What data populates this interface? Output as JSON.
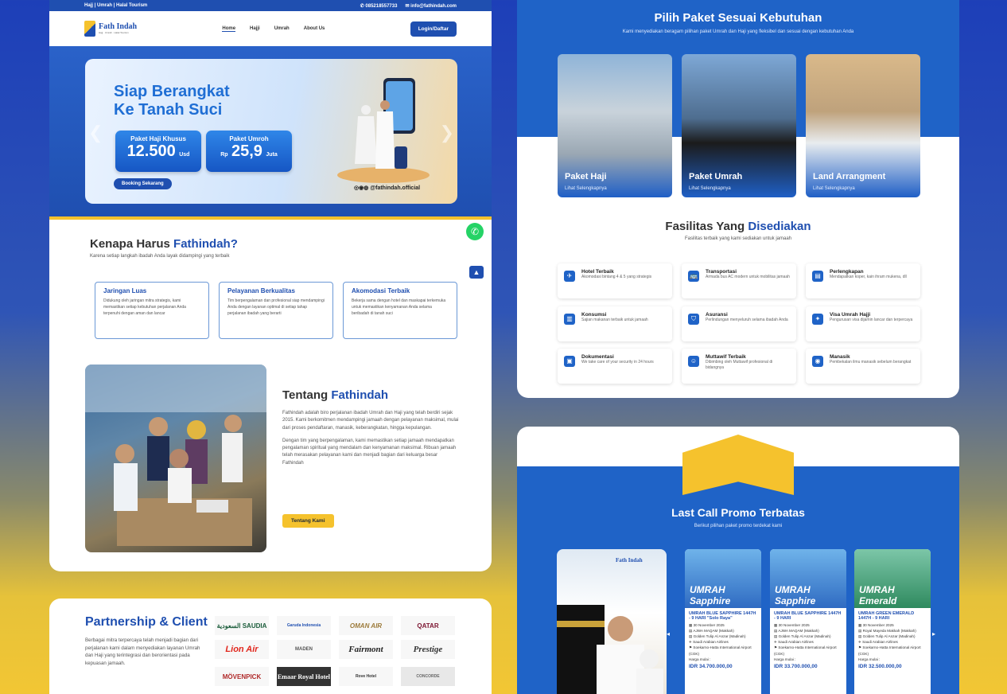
{
  "topbar": {
    "left": "Hajj | Umrah | Halal Tourism",
    "phone": "✆ 085218557733",
    "email": "✉ info@fathindah.com"
  },
  "brand": {
    "name": "Fath Indah",
    "tagline": "Hajj · Umrah · Halal Tourism"
  },
  "nav": {
    "items": [
      "Home",
      "Hajji",
      "Umrah",
      "About Us"
    ],
    "login": "Login/Daftar"
  },
  "hero": {
    "line1": "Siap Berangkat",
    "line2": "Ke Tanah Suci",
    "haji_title": "Paket Haji Khusus",
    "haji_value": "12.500",
    "haji_unit": "Usd",
    "umroh_title": "Paket Umroh",
    "umroh_prefix": "Rp",
    "umroh_value": "25,9",
    "umroh_unit": "Juta",
    "cta": "Booking Sekarang",
    "handle": "@fathindah.official"
  },
  "why": {
    "title_a": "Kenapa Harus",
    "title_b": "Fathindah?",
    "subtitle": "Karena setiap langkah ibadah Anda layak didampingi yang terbaik",
    "cards": [
      {
        "title": "Jaringan Luas",
        "desc": "Didukung oleh jaringan mitra strategis, kami memastikan setiap kebutuhan perjalanan Anda terpenuhi dengan aman dan lancar"
      },
      {
        "title": "Pelayanan Berkualitas",
        "desc": "Tim berpengalaman dan profesional siap mendampingi Anda dengan layanan optimal di setiap tahap perjalanan ibadah yang berarti"
      },
      {
        "title": "Akomodasi Terbaik",
        "desc": "Bekerja sama dengan hotel dan maskapai terkemuka untuk memastikan kenyamanan Anda selama beribadah di tanah suci"
      }
    ]
  },
  "about": {
    "title_a": "Tentang",
    "title_b": "Fathindah",
    "p1": "Fathindah adalah biro perjalanan ibadah Umrah dan Haji yang telah berdiri sejak 2015. Kami berkomitmen mendampingi jamaah dengan pelayanan maksimal, mulai dari proses pendaftaran, manasik, keberangkatan, hingga kepulangan.",
    "p2": "Dengan tim yang berpengalaman, kami memastikan setiap jamaah mendapatkan pengalaman spiritual yang mendalam dan kenyamanan maksimal. Ribuan jamaah telah merasakan pelayanan kami dan menjadi bagian dari keluarga besar Fathindah",
    "cta": "Tentang Kami"
  },
  "partner": {
    "title": "Partnership & Client",
    "desc": "Berbagai mitra terpercaya telah menjadi bagian dari perjalanan kami dalam menyediakan layanan Umrah dan Haji yang terintegrasi dan berorientasi pada kepuasan jamaah.",
    "logos": [
      "السعودية SAUDIA",
      "Garuda Indonesia",
      "OMAN AIR",
      "QATAR",
      "Lion Air",
      "MADEN",
      "Fairmont",
      "Prestige",
      "MÖVENPICK",
      "Emaar Royal Hotel",
      "Rove Hotel",
      "CONCORDE"
    ]
  },
  "packages": {
    "title": "Pilih Paket Sesuai Kebutuhan",
    "subtitle": "Kami menyediakan beragam pilihan paket Umrah dan Haji yang fleksibel dan sesuai dengan kebutuhan Anda",
    "items": [
      {
        "title": "Paket Haji",
        "link": "Lihat Selengkapnya"
      },
      {
        "title": "Paket Umrah",
        "link": "Lihat Selengkapnya"
      },
      {
        "title": "Land Arrangment",
        "link": "Lihat Selengkapnya"
      }
    ]
  },
  "facilities": {
    "title_a": "Fasilitas Yang",
    "title_b": "Disediakan",
    "subtitle": "Fasilitas terbaik yang kami sediakan untuk jamaah",
    "items": [
      {
        "title": "Hotel Terbaik",
        "desc": "Akomodasi bintang 4 & 5 yang strategis",
        "icon": "✈"
      },
      {
        "title": "Transportasi",
        "desc": "Armada bus AC modern untuk mobilitas jamaah",
        "icon": "🚌"
      },
      {
        "title": "Perlengkapan",
        "desc": "Mendapatkan koper, kain ihram mukena, dll",
        "icon": "▤"
      },
      {
        "title": "Konsumsi",
        "desc": "Sajian makanan terbaik untuk jamaah",
        "icon": "▥"
      },
      {
        "title": "Asuransi",
        "desc": "Perlindungan menyeluruh selama ibadah Anda",
        "icon": "⛉"
      },
      {
        "title": "Visa Umrah Hajji",
        "desc": "Pengurusan visa dijamin lancar dan terpercaya",
        "icon": "✦"
      },
      {
        "title": "Dokumentasi",
        "desc": "We take care of your security in 24 hours",
        "icon": "▣"
      },
      {
        "title": "Muttawif Terbaik",
        "desc": "Dibimbing oleh Muttawif profesional di bidangnya",
        "icon": "☺"
      },
      {
        "title": "Manasik",
        "desc": "Pembekalan ilmu manasik sebelum berangkat",
        "icon": "◉"
      }
    ]
  },
  "promo": {
    "title": "Last Call Promo Terbatas",
    "subtitle": "Berikut pilihan paket promo terdekat kami",
    "items": [
      {
        "badge": "UMRAH Sapphire",
        "title": "UMRAH BLUE SAPPHIRE 1447H - 9 HARI \"Solo Raya\"",
        "date": "30 November 2025",
        "l1": "AJWA MAQAM (Makkah)",
        "l2": "Golden Tulip Al Anzar (Madinah)",
        "l3": "Saudi Arabian Airlines",
        "l4": "Soekarno-Hatta International Airport (CGK)",
        "label": "Harga mulai :",
        "price": "IDR 34.700.000,00"
      },
      {
        "badge": "UMRAH Sapphire",
        "title": "UMRAH BLUE SAPPHIRE 1447H - 9 HARI",
        "date": "30 November 2025",
        "l1": "AJWA MAQAM (Makkah)",
        "l2": "Golden Tulip Al Anzar (Madinah)",
        "l3": "Saudi Arabian Airlines",
        "l4": "Soekarno-Hatta International Airport (CGK)",
        "label": "Harga mulai :",
        "price": "IDR 33.700.000,00"
      },
      {
        "badge": "UMRAH Emerald",
        "title": "UMRAH GREEN EMERALD 1447H - 9 HARI",
        "date": "30 November 2025",
        "l1": "Royal Mayeda Makkah (Makkah)",
        "l2": "Golden Tulip Al Anzar (Madinah)",
        "l3": "Saudi Arabian Airlines",
        "l4": "Soekarno-Hatta International Airport (CGK)",
        "label": "Harga mulai :",
        "price": "IDR 32.500.000,00"
      }
    ]
  },
  "colors": {
    "primary": "#1f4fb0",
    "accent": "#f5c22d"
  }
}
